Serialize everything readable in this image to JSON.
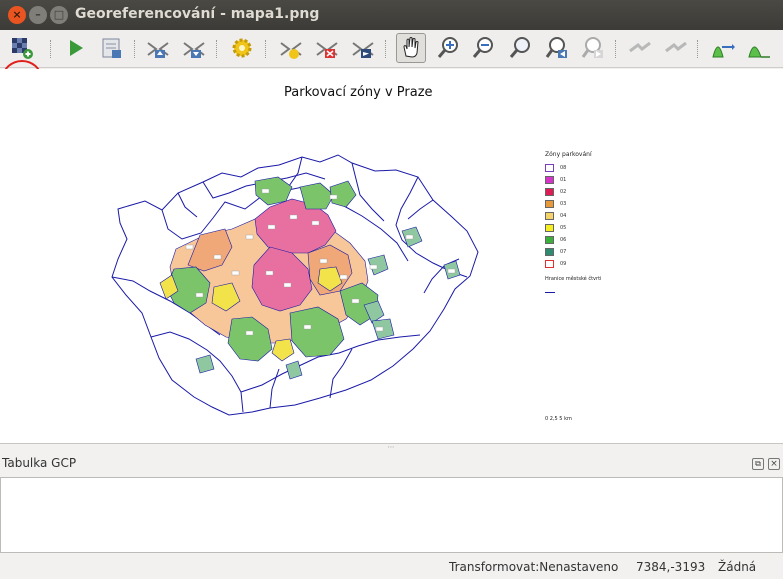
{
  "window": {
    "title": "Georeferencování - mapa1.png",
    "close_glyph": "×",
    "min_glyph": "–",
    "max_glyph": "□"
  },
  "toolbar": {
    "items": [
      {
        "name": "open-raster-button",
        "icon": "open-raster-icon"
      },
      {
        "name": "start-georeferencing-button",
        "icon": "play-icon"
      },
      {
        "name": "generate-gdal-script-button",
        "icon": "script-icon"
      },
      {
        "name": "load-gcp-points-button",
        "icon": "load-gcp-icon"
      },
      {
        "name": "save-gcp-points-button",
        "icon": "save-gcp-icon"
      },
      {
        "name": "transformation-settings-button",
        "icon": "gear-icon"
      },
      {
        "name": "add-point-button",
        "icon": "add-point-icon"
      },
      {
        "name": "delete-point-button",
        "icon": "delete-point-icon"
      },
      {
        "name": "move-gcp-point-button",
        "icon": "move-point-icon"
      },
      {
        "name": "pan-button",
        "icon": "hand-icon"
      },
      {
        "name": "zoom-in-button",
        "icon": "zoom-in-icon"
      },
      {
        "name": "zoom-out-button",
        "icon": "zoom-out-icon"
      },
      {
        "name": "zoom-to-layer-button",
        "icon": "zoom-full-icon"
      },
      {
        "name": "zoom-last-button",
        "icon": "zoom-last-icon"
      },
      {
        "name": "zoom-next-button",
        "icon": "zoom-next-icon"
      },
      {
        "name": "link-georef-to-qgis-button",
        "icon": "link-georef-icon"
      },
      {
        "name": "link-qgis-to-georef-button",
        "icon": "link-qgis-icon"
      },
      {
        "name": "full-histogram-stretch-button",
        "icon": "histogram-full-icon"
      },
      {
        "name": "local-histogram-stretch-button",
        "icon": "histogram-local-icon"
      }
    ],
    "colors": {
      "accent_green": "#3a9a3a",
      "gear_yellow": "#f0c419",
      "highlight_red": "#e0201c"
    }
  },
  "map": {
    "title": "Parkovací zóny v Praze",
    "legend": {
      "title": "Zóny parkování",
      "items": [
        {
          "code": "08",
          "color": "#ffffff",
          "border": "#7a3fc0"
        },
        {
          "code": "01",
          "color": "#d633c8",
          "border": "#666666"
        },
        {
          "code": "02",
          "color": "#e01a55",
          "border": "#666666"
        },
        {
          "code": "03",
          "color": "#e89a3a",
          "border": "#666666"
        },
        {
          "code": "04",
          "color": "#f5d36b",
          "border": "#666666"
        },
        {
          "code": "05",
          "color": "#f5ef1f",
          "border": "#666666"
        },
        {
          "code": "06",
          "color": "#3cae3c",
          "border": "#666666"
        },
        {
          "code": "07",
          "color": "#2e8b6f",
          "border": "#666666"
        },
        {
          "code": "09",
          "color": "#ffffff",
          "border": "#e03030"
        }
      ],
      "boundary_label": "Hranice městské čtvrti"
    },
    "scale_text": "0 2,5 5 km",
    "colors": {
      "boundary": "#1a1aa8",
      "salmon": "#f0a878",
      "pink": "#e870a0",
      "green": "#7cc46a",
      "peach": "#f7c79a",
      "yellow": "#f2e34a",
      "teal": "#8fc8a0"
    }
  },
  "gcp_panel": {
    "title": "Tabulka GCP",
    "float_glyph": "⧉",
    "close_glyph": "×"
  },
  "statusbar": {
    "transform": "Transformovat:Nenastaveno",
    "coords": "7384,-3193",
    "srs": "Žádná"
  }
}
